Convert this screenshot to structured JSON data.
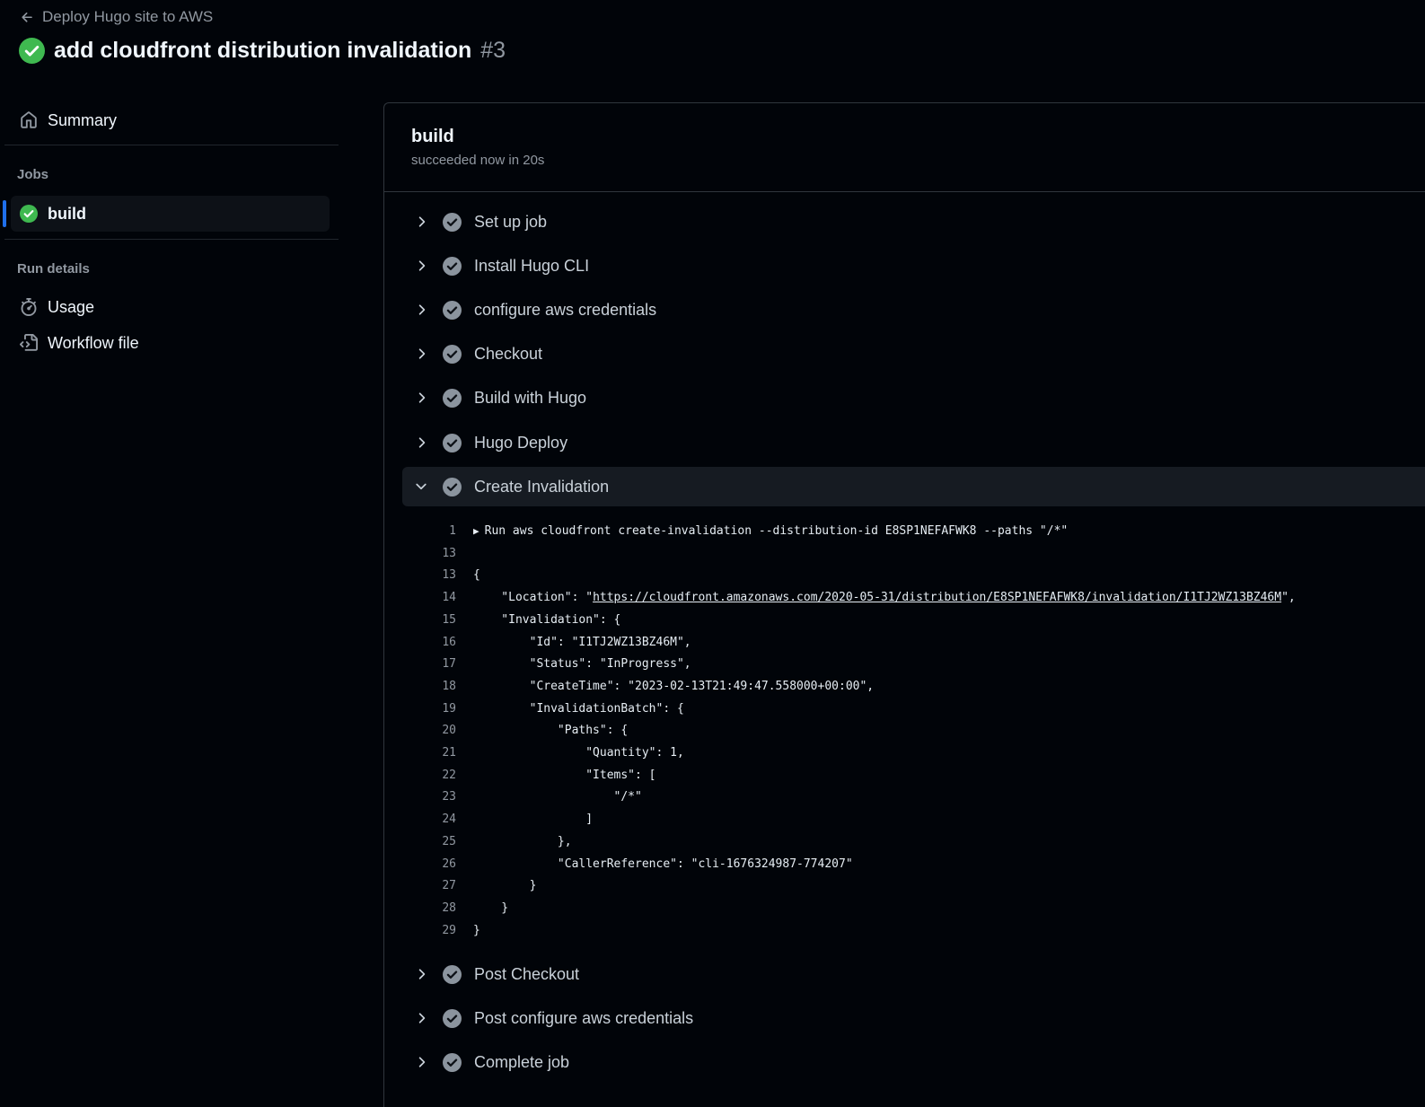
{
  "header": {
    "back_label": "Deploy Hugo site to AWS",
    "run_title": "add cloudfront distribution invalidation",
    "run_number": "#3"
  },
  "sidebar": {
    "summary_label": "Summary",
    "jobs_heading": "Jobs",
    "job_label": "build",
    "run_details_heading": "Run details",
    "usage_label": "Usage",
    "workflow_file_label": "Workflow file"
  },
  "job": {
    "name": "build",
    "status": "succeeded now in 20s"
  },
  "steps": [
    {
      "label": "Set up job"
    },
    {
      "label": "Install Hugo CLI"
    },
    {
      "label": "configure aws credentials"
    },
    {
      "label": "Checkout"
    },
    {
      "label": "Build with Hugo"
    },
    {
      "label": "Hugo Deploy"
    },
    {
      "label": "Create Invalidation"
    },
    {
      "label": "Post Checkout"
    },
    {
      "label": "Post configure aws credentials"
    },
    {
      "label": "Complete job"
    }
  ],
  "log": {
    "run_line": {
      "num": "1",
      "text": "Run aws cloudfront create-invalidation --distribution-id E8SP1NEFAFWK8 --paths \"/*\""
    },
    "lines": [
      {
        "num": "13",
        "text": ""
      },
      {
        "num": "13",
        "text": "{"
      },
      {
        "num": "14",
        "pre": "    \"Location\": \"",
        "link": "https://cloudfront.amazonaws.com/2020-05-31/distribution/E8SP1NEFAFWK8/invalidation/I1TJ2WZ13BZ46M",
        "post": "\","
      },
      {
        "num": "15",
        "text": "    \"Invalidation\": {"
      },
      {
        "num": "16",
        "text": "        \"Id\": \"I1TJ2WZ13BZ46M\","
      },
      {
        "num": "17",
        "text": "        \"Status\": \"InProgress\","
      },
      {
        "num": "18",
        "text": "        \"CreateTime\": \"2023-02-13T21:49:47.558000+00:00\","
      },
      {
        "num": "19",
        "text": "        \"InvalidationBatch\": {"
      },
      {
        "num": "20",
        "text": "            \"Paths\": {"
      },
      {
        "num": "21",
        "text": "                \"Quantity\": 1,"
      },
      {
        "num": "22",
        "text": "                \"Items\": ["
      },
      {
        "num": "23",
        "text": "                    \"/*\""
      },
      {
        "num": "24",
        "text": "                ]"
      },
      {
        "num": "25",
        "text": "            },"
      },
      {
        "num": "26",
        "text": "            \"CallerReference\": \"cli-1676324987-774207\""
      },
      {
        "num": "27",
        "text": "        }"
      },
      {
        "num": "28",
        "text": "    }"
      },
      {
        "num": "29",
        "text": "}"
      }
    ]
  },
  "colors": {
    "success": "#3fb950",
    "step_check": "#8b949e",
    "accent": "#1f6feb"
  },
  "icons": [
    "arrow-left-icon",
    "check-circle-fill-icon",
    "home-icon",
    "stopwatch-icon",
    "file-code-icon",
    "chevron-right-icon",
    "chevron-down-icon",
    "triangle-right-icon"
  ]
}
